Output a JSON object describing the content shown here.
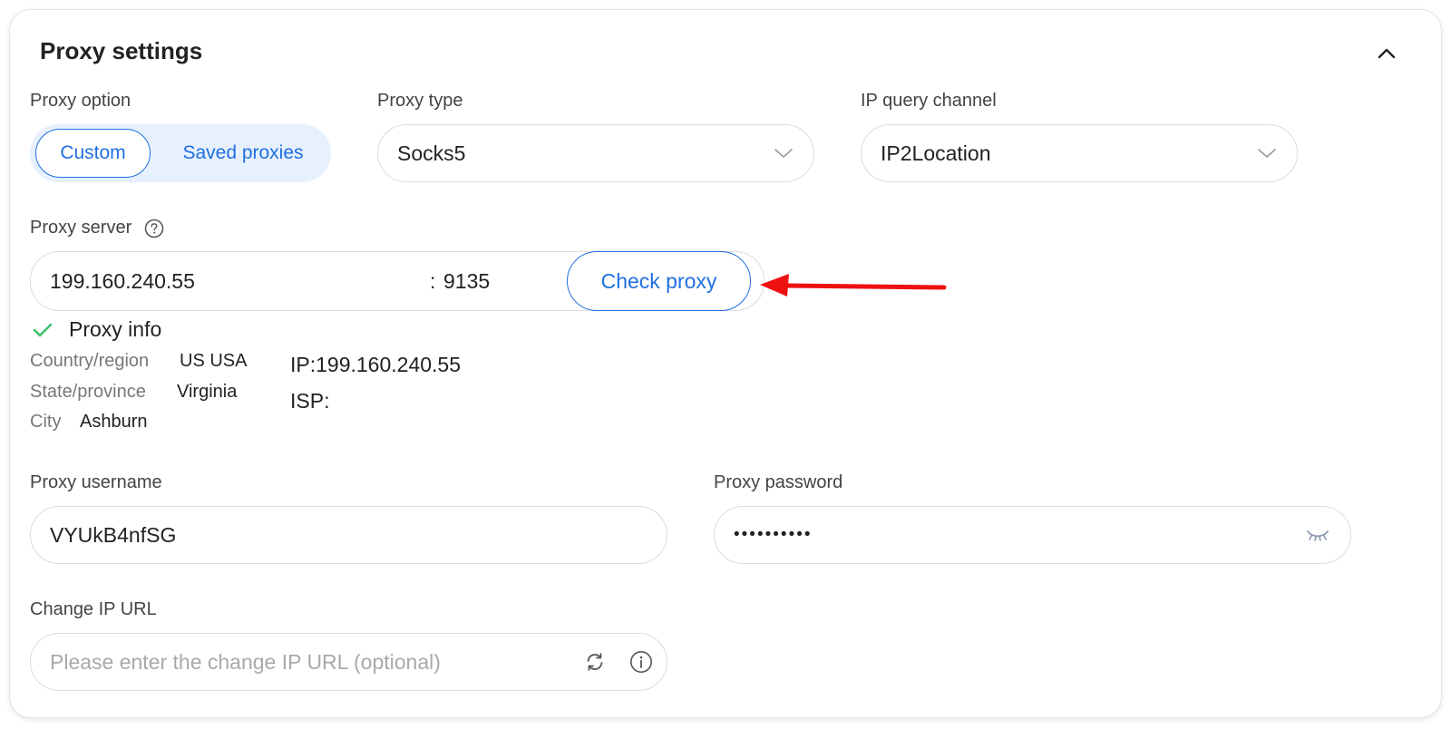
{
  "title": "Proxy settings",
  "proxy_option": {
    "label": "Proxy option",
    "options": [
      "Custom",
      "Saved proxies"
    ],
    "selected": "Custom"
  },
  "proxy_type": {
    "label": "Proxy type",
    "value": "Socks5"
  },
  "ip_query_channel": {
    "label": "IP query channel",
    "value": "IP2Location"
  },
  "proxy_server": {
    "label": "Proxy server",
    "host": "199.160.240.55",
    "port_separator": ":",
    "port": "9135",
    "check_button": "Check proxy"
  },
  "proxy_info": {
    "title": "Proxy info",
    "country_key": "Country/region",
    "country_val": "US USA",
    "state_key": "State/province",
    "state_val": "Virginia",
    "city_key": "City",
    "city_val": "Ashburn",
    "ip_line": "IP:199.160.240.55",
    "isp_line": "ISP:"
  },
  "username": {
    "label": "Proxy username",
    "value": "VYUkB4nfSG"
  },
  "password": {
    "label": "Proxy password",
    "masked": "••••••••••"
  },
  "change_ip": {
    "label": "Change IP URL",
    "placeholder": "Please enter the change IP URL (optional)"
  },
  "colors": {
    "accent": "#1f6fe0",
    "success": "#3cc36b",
    "annotation_arrow": "#ee1111"
  },
  "icons": [
    "chevron-up-icon",
    "chevron-down-icon",
    "help-circle-icon",
    "check-icon",
    "eye-closed-icon",
    "refresh-icon",
    "info-icon"
  ]
}
